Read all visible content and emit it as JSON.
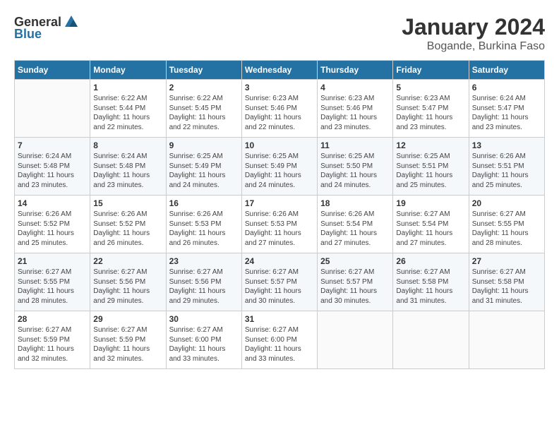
{
  "logo": {
    "general": "General",
    "blue": "Blue"
  },
  "header": {
    "title": "January 2024",
    "subtitle": "Bogande, Burkina Faso"
  },
  "weekdays": [
    "Sunday",
    "Monday",
    "Tuesday",
    "Wednesday",
    "Thursday",
    "Friday",
    "Saturday"
  ],
  "weeks": [
    [
      {
        "day": "",
        "info": ""
      },
      {
        "day": "1",
        "info": "Sunrise: 6:22 AM\nSunset: 5:44 PM\nDaylight: 11 hours\nand 22 minutes."
      },
      {
        "day": "2",
        "info": "Sunrise: 6:22 AM\nSunset: 5:45 PM\nDaylight: 11 hours\nand 22 minutes."
      },
      {
        "day": "3",
        "info": "Sunrise: 6:23 AM\nSunset: 5:46 PM\nDaylight: 11 hours\nand 22 minutes."
      },
      {
        "day": "4",
        "info": "Sunrise: 6:23 AM\nSunset: 5:46 PM\nDaylight: 11 hours\nand 23 minutes."
      },
      {
        "day": "5",
        "info": "Sunrise: 6:23 AM\nSunset: 5:47 PM\nDaylight: 11 hours\nand 23 minutes."
      },
      {
        "day": "6",
        "info": "Sunrise: 6:24 AM\nSunset: 5:47 PM\nDaylight: 11 hours\nand 23 minutes."
      }
    ],
    [
      {
        "day": "7",
        "info": "Sunrise: 6:24 AM\nSunset: 5:48 PM\nDaylight: 11 hours\nand 23 minutes."
      },
      {
        "day": "8",
        "info": "Sunrise: 6:24 AM\nSunset: 5:48 PM\nDaylight: 11 hours\nand 23 minutes."
      },
      {
        "day": "9",
        "info": "Sunrise: 6:25 AM\nSunset: 5:49 PM\nDaylight: 11 hours\nand 24 minutes."
      },
      {
        "day": "10",
        "info": "Sunrise: 6:25 AM\nSunset: 5:49 PM\nDaylight: 11 hours\nand 24 minutes."
      },
      {
        "day": "11",
        "info": "Sunrise: 6:25 AM\nSunset: 5:50 PM\nDaylight: 11 hours\nand 24 minutes."
      },
      {
        "day": "12",
        "info": "Sunrise: 6:25 AM\nSunset: 5:51 PM\nDaylight: 11 hours\nand 25 minutes."
      },
      {
        "day": "13",
        "info": "Sunrise: 6:26 AM\nSunset: 5:51 PM\nDaylight: 11 hours\nand 25 minutes."
      }
    ],
    [
      {
        "day": "14",
        "info": "Sunrise: 6:26 AM\nSunset: 5:52 PM\nDaylight: 11 hours\nand 25 minutes."
      },
      {
        "day": "15",
        "info": "Sunrise: 6:26 AM\nSunset: 5:52 PM\nDaylight: 11 hours\nand 26 minutes."
      },
      {
        "day": "16",
        "info": "Sunrise: 6:26 AM\nSunset: 5:53 PM\nDaylight: 11 hours\nand 26 minutes."
      },
      {
        "day": "17",
        "info": "Sunrise: 6:26 AM\nSunset: 5:53 PM\nDaylight: 11 hours\nand 27 minutes."
      },
      {
        "day": "18",
        "info": "Sunrise: 6:26 AM\nSunset: 5:54 PM\nDaylight: 11 hours\nand 27 minutes."
      },
      {
        "day": "19",
        "info": "Sunrise: 6:27 AM\nSunset: 5:54 PM\nDaylight: 11 hours\nand 27 minutes."
      },
      {
        "day": "20",
        "info": "Sunrise: 6:27 AM\nSunset: 5:55 PM\nDaylight: 11 hours\nand 28 minutes."
      }
    ],
    [
      {
        "day": "21",
        "info": "Sunrise: 6:27 AM\nSunset: 5:55 PM\nDaylight: 11 hours\nand 28 minutes."
      },
      {
        "day": "22",
        "info": "Sunrise: 6:27 AM\nSunset: 5:56 PM\nDaylight: 11 hours\nand 29 minutes."
      },
      {
        "day": "23",
        "info": "Sunrise: 6:27 AM\nSunset: 5:56 PM\nDaylight: 11 hours\nand 29 minutes."
      },
      {
        "day": "24",
        "info": "Sunrise: 6:27 AM\nSunset: 5:57 PM\nDaylight: 11 hours\nand 30 minutes."
      },
      {
        "day": "25",
        "info": "Sunrise: 6:27 AM\nSunset: 5:57 PM\nDaylight: 11 hours\nand 30 minutes."
      },
      {
        "day": "26",
        "info": "Sunrise: 6:27 AM\nSunset: 5:58 PM\nDaylight: 11 hours\nand 31 minutes."
      },
      {
        "day": "27",
        "info": "Sunrise: 6:27 AM\nSunset: 5:58 PM\nDaylight: 11 hours\nand 31 minutes."
      }
    ],
    [
      {
        "day": "28",
        "info": "Sunrise: 6:27 AM\nSunset: 5:59 PM\nDaylight: 11 hours\nand 32 minutes."
      },
      {
        "day": "29",
        "info": "Sunrise: 6:27 AM\nSunset: 5:59 PM\nDaylight: 11 hours\nand 32 minutes."
      },
      {
        "day": "30",
        "info": "Sunrise: 6:27 AM\nSunset: 6:00 PM\nDaylight: 11 hours\nand 33 minutes."
      },
      {
        "day": "31",
        "info": "Sunrise: 6:27 AM\nSunset: 6:00 PM\nDaylight: 11 hours\nand 33 minutes."
      },
      {
        "day": "",
        "info": ""
      },
      {
        "day": "",
        "info": ""
      },
      {
        "day": "",
        "info": ""
      }
    ]
  ]
}
